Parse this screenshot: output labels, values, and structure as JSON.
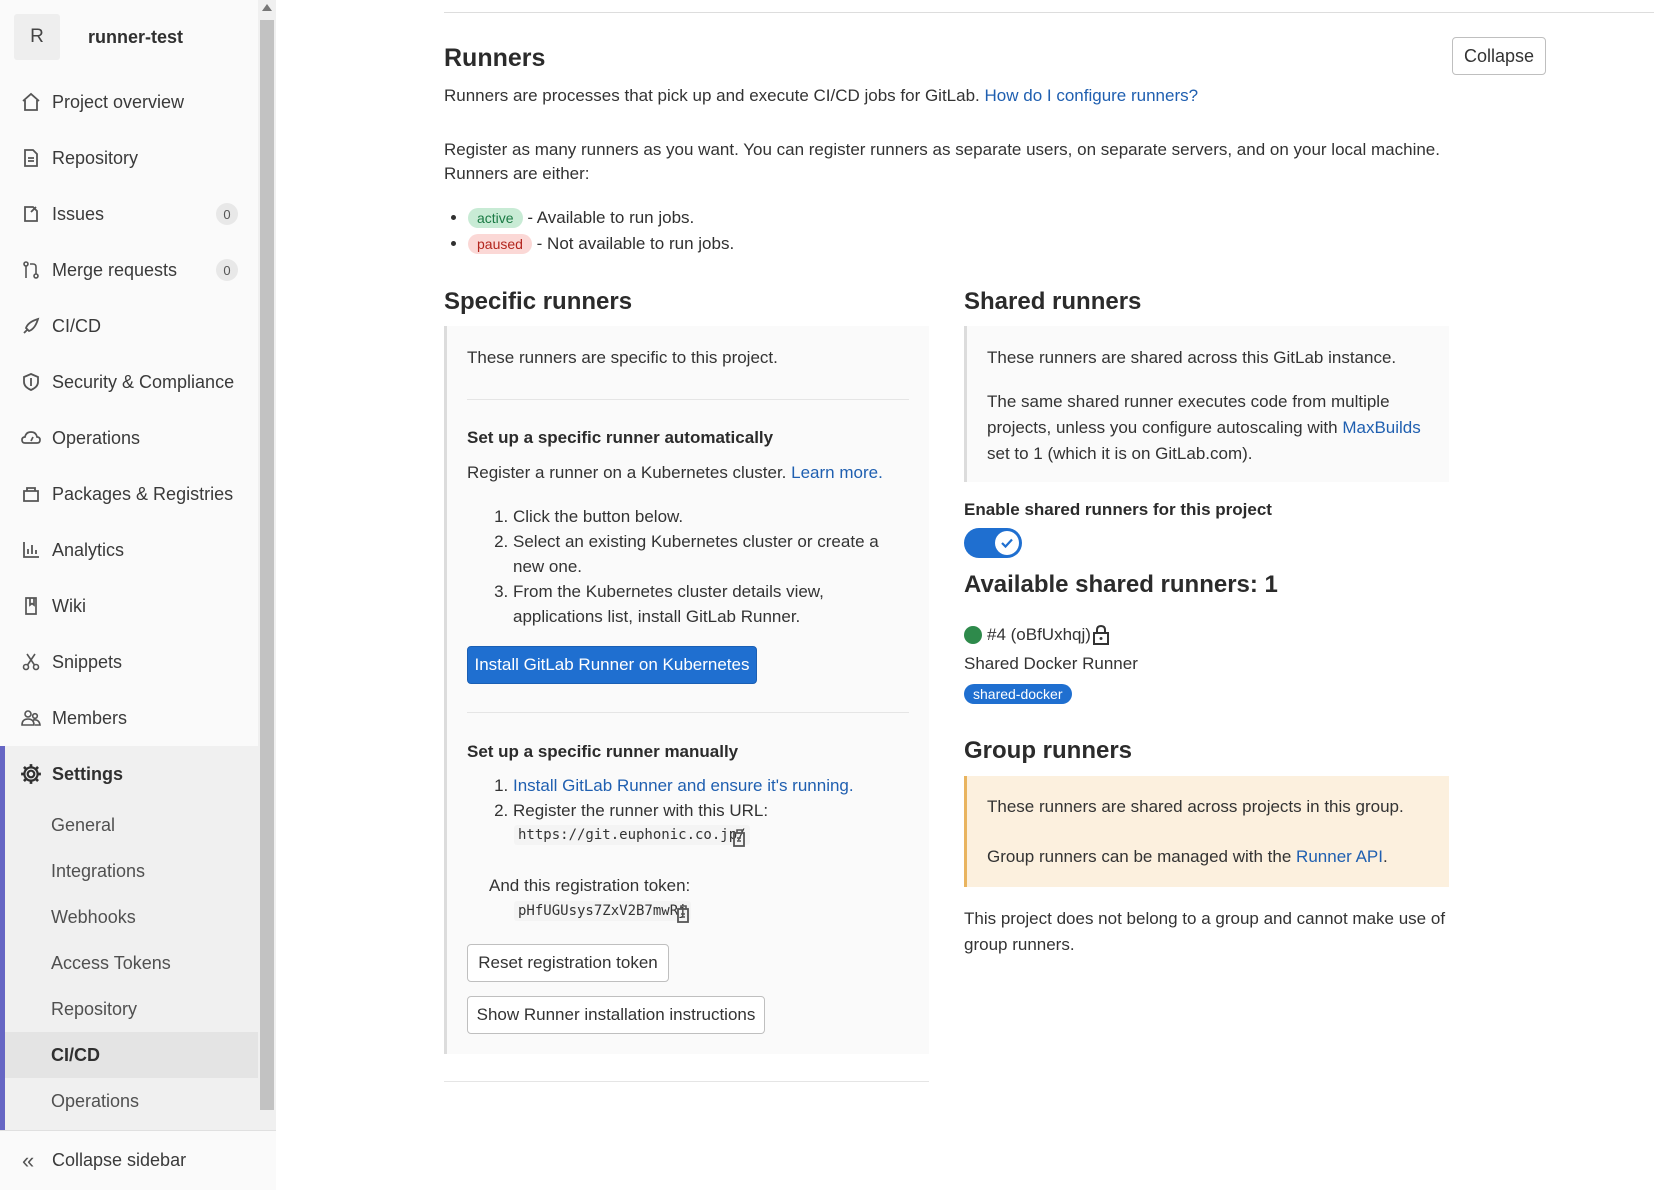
{
  "project": {
    "avatar_letter": "R",
    "name": "runner-test"
  },
  "nav": {
    "items": [
      {
        "label": "Project overview"
      },
      {
        "label": "Repository"
      },
      {
        "label": "Issues",
        "count": "0"
      },
      {
        "label": "Merge requests",
        "count": "0"
      },
      {
        "label": "CI/CD"
      },
      {
        "label": "Security & Compliance"
      },
      {
        "label": "Operations"
      },
      {
        "label": "Packages & Registries"
      },
      {
        "label": "Analytics"
      },
      {
        "label": "Wiki"
      },
      {
        "label": "Snippets"
      },
      {
        "label": "Members"
      }
    ],
    "settings": {
      "label": "Settings",
      "sub": [
        "General",
        "Integrations",
        "Webhooks",
        "Access Tokens",
        "Repository",
        "CI/CD",
        "Operations"
      ],
      "active": "CI/CD"
    },
    "collapse_label": "Collapse sidebar"
  },
  "runners": {
    "title": "Runners",
    "collapse_button": "Collapse",
    "intro": "Runners are processes that pick up and execute CI/CD jobs for GitLab.",
    "intro_link": "How do I configure runners?",
    "register_line1": "Register as many runners as you want. You can register runners as separate users, on separate servers, and on your local machine.",
    "register_line2": "Runners are either:",
    "states": [
      {
        "badge": "active",
        "text": "- Available to run jobs."
      },
      {
        "badge": "paused",
        "text": "- Not available to run jobs."
      }
    ]
  },
  "specific": {
    "title": "Specific runners",
    "desc": "These runners are specific to this project.",
    "auto_title": "Set up a specific runner automatically",
    "auto_desc": "Register a runner on a Kubernetes cluster.",
    "auto_link": "Learn more.",
    "auto_steps": [
      "Click the button below.",
      "Select an existing Kubernetes cluster or create a new one.",
      "From the Kubernetes cluster details view, applications list, install GitLab Runner."
    ],
    "install_button": "Install GitLab Runner on Kubernetes",
    "manual_title": "Set up a specific runner manually",
    "manual_step1_link": "Install GitLab Runner and ensure it's running.",
    "manual_step2": "Register the runner with this URL:",
    "url": "https://git.euphonic.co.jp/",
    "token_label": "And this registration token:",
    "token": "pHfUGUsys7ZxV2B7mwRj",
    "reset_button": "Reset registration token",
    "show_button": "Show Runner installation instructions"
  },
  "shared": {
    "title": "Shared runners",
    "desc1": "These runners are shared across this GitLab instance.",
    "desc2": "The same shared runner executes code from multiple projects, unless you configure autoscaling with",
    "desc2_link": "MaxBuilds",
    "desc2_tail": "set to 1 (which it is on GitLab.com).",
    "enable_label": "Enable shared runners for this project",
    "enabled": true,
    "available_title": "Available shared runners: 1",
    "runner_id": "#4 (oBfUxhqj)",
    "runner_name": "Shared Docker Runner",
    "runner_tag": "shared-docker"
  },
  "group": {
    "title": "Group runners",
    "desc1": "These runners are shared across projects in this group.",
    "desc2": "Group runners can be managed with the",
    "desc2_link": "Runner API",
    "desc2_tail": ".",
    "note": "This project does not belong to a group and cannot make use of group runners."
  },
  "colors": {
    "primary": "#1f6fd0",
    "link": "#1f5fb0",
    "active_nav_border": "#6666c4",
    "online": "#2e8a4b"
  }
}
